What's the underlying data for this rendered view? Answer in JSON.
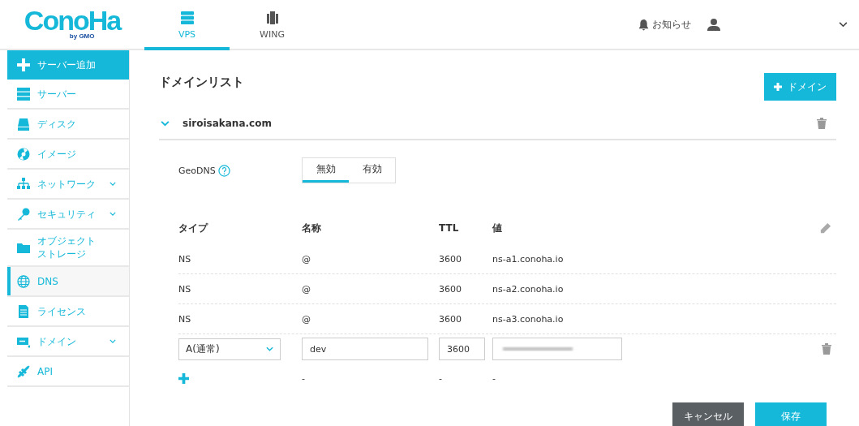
{
  "header": {
    "logo": {
      "name": "ConoHa",
      "sub": "by GMO"
    },
    "tabs": [
      {
        "label": "VPS",
        "selected": true
      },
      {
        "label": "WING",
        "selected": false
      }
    ],
    "notice": "お知らせ"
  },
  "sidebar": {
    "items": [
      {
        "label": "サーバー追加",
        "kind": "action",
        "selected": false,
        "expandable": false
      },
      {
        "label": "サーバー",
        "kind": "link",
        "selected": false,
        "expandable": false
      },
      {
        "label": "ディスク",
        "kind": "link",
        "selected": false,
        "expandable": false
      },
      {
        "label": "イメージ",
        "kind": "link",
        "selected": false,
        "expandable": false
      },
      {
        "label": "ネットワーク",
        "kind": "link",
        "selected": false,
        "expandable": true
      },
      {
        "label": "セキュリティ",
        "kind": "link",
        "selected": false,
        "expandable": true
      },
      {
        "label": "オブジェクトストレージ",
        "kind": "link",
        "selected": false,
        "expandable": false
      },
      {
        "label": "DNS",
        "kind": "link",
        "selected": true,
        "expandable": false
      },
      {
        "label": "ライセンス",
        "kind": "link",
        "selected": false,
        "expandable": false
      },
      {
        "label": "ドメイン",
        "kind": "link",
        "selected": false,
        "expandable": true
      },
      {
        "label": "API",
        "kind": "link",
        "selected": false,
        "expandable": false
      }
    ]
  },
  "main": {
    "title": "ドメインリスト",
    "add_button": "ドメイン",
    "domain": {
      "name": "siroisakana.com",
      "expanded": true,
      "geodns": {
        "label": "GeoDNS",
        "options": [
          {
            "label": "無効",
            "selected": true
          },
          {
            "label": "有効",
            "selected": false
          }
        ]
      },
      "columns": [
        "タイプ",
        "名称",
        "TTL",
        "値"
      ],
      "records": [
        {
          "kind": "static",
          "type": "NS",
          "name": "@",
          "ttl": "3600",
          "value": "ns-a1.conoha.io"
        },
        {
          "kind": "static",
          "type": "NS",
          "name": "@",
          "ttl": "3600",
          "value": "ns-a2.conoha.io"
        },
        {
          "kind": "static",
          "type": "NS",
          "name": "@",
          "ttl": "3600",
          "value": "ns-a3.conoha.io"
        },
        {
          "kind": "edit",
          "type": "A(通常)",
          "name": "dev",
          "ttl": "3600"
        },
        {
          "kind": "new",
          "name": "-",
          "ttl": "-",
          "value": "-"
        }
      ]
    },
    "buttons": [
      {
        "label": "キャンセル",
        "kind": "secondary"
      },
      {
        "label": "保存",
        "kind": "primary"
      }
    ]
  }
}
